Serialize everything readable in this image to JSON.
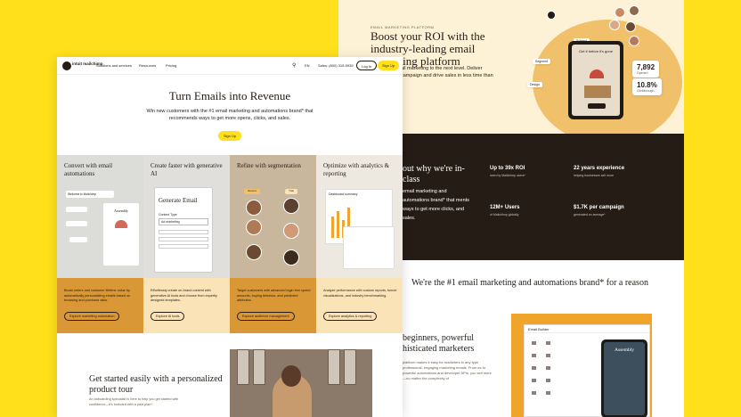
{
  "colors": {
    "brand": "#ffe01b",
    "dark": "#241c15",
    "orange": "#f0a429"
  },
  "back": {
    "eyebrow": "EMAIL MARKETING PLATFORM",
    "headline": "Boost your ROI with the industry-leading email marketing platform",
    "sub": "ail marketing to the next level. Deliver campaign and drive sales in less time than",
    "phone_title": "Get it before it's gone",
    "stat1_value": "7,892",
    "stat1_label": "Opened",
    "stat2_value": "10.8%",
    "stat2_label": "Clickthrough",
    "why": "out why we're in-class",
    "why_sub": "email marketing and automations brand* that ments ways to get more clicks, and sales.",
    "stats": [
      {
        "value": "Up to 39x ROI",
        "label": "seen by Mailchimp users*"
      },
      {
        "value": "22 years experience",
        "label": "helping businesses sell more"
      },
      {
        "value": "12M+ Users",
        "label": "of Mailchimp globally"
      },
      {
        "value": "$1.7K per campaign",
        "label": "generated on average*"
      }
    ],
    "reason": "We're the #1 email marketing and automations brand* for a reason",
    "beginners": "beginners, powerful histicated marketers",
    "beginners_sub": "platform makes it easy for marketers in any type professional, engaging marketing emails. From es to powerful automations and developer APIs, you sell more—no matter the complexity of",
    "builder_title": "Email Builder",
    "builder_phone": "Assembly"
  },
  "front": {
    "logo_text": "intuit mailchimp",
    "nav": [
      "Solutions and services",
      "Resources",
      "Pricing"
    ],
    "lang": "EN",
    "sales": "Sales: (800) 315-5939",
    "login": "Log In",
    "signup": "Sign Up",
    "hero_title": "Turn Emails into Revenue",
    "hero_sub": "Win new customers with the #1 email marketing and automations brand* that recommends ways to get more opens, clicks, and sales.",
    "hero_cta": "Sign Up",
    "columns": [
      {
        "title": "Convert with email automations",
        "desc": "Boost orders and customer lifetime value by automatically personalizing emails based on browsing and purchase data.",
        "btn": "Explore marketing automation",
        "bg": "#dcdcd9",
        "desc_bg": "#d99735"
      },
      {
        "title": "Create faster with generative AI",
        "desc": "Effortlessly create on-brand content with generative AI tools and choose from expertly designed templates.",
        "btn": "Explore AI tools",
        "bg": "#e0dfdc",
        "desc_bg": "#fbe3b8"
      },
      {
        "title": "Refine with segmentation",
        "desc": "Target customers with advanced login free speed amounts, buying behavior, and predicted attributes.",
        "btn": "Explore audience management",
        "bg": "#c9b79d",
        "desc_bg": "#d99735"
      },
      {
        "title": "Optimize with analytics & reporting",
        "desc": "Analyze performance with custom reports, funnel visualizations, and industry benchmarking.",
        "btn": "Explore analytics & reporting",
        "bg": "#ede9e0",
        "desc_bg": "#fbe3b8"
      }
    ],
    "col1_card": "Welcome to Mailchimp",
    "col1_assembly": "Assembly",
    "col2_card_title": "Generate Email",
    "col2_card_label": "Content Type",
    "col2_card_value": "Ad marketing",
    "col3_tag1": "Recent",
    "col3_tag2": "Trial",
    "col4_card": "Dashboard summary",
    "tour_title": "Get started easily with a personalized product tour",
    "tour_sub": "An onboarding specialist is here to help you get started with confidence—it's included with a paid plan*."
  }
}
